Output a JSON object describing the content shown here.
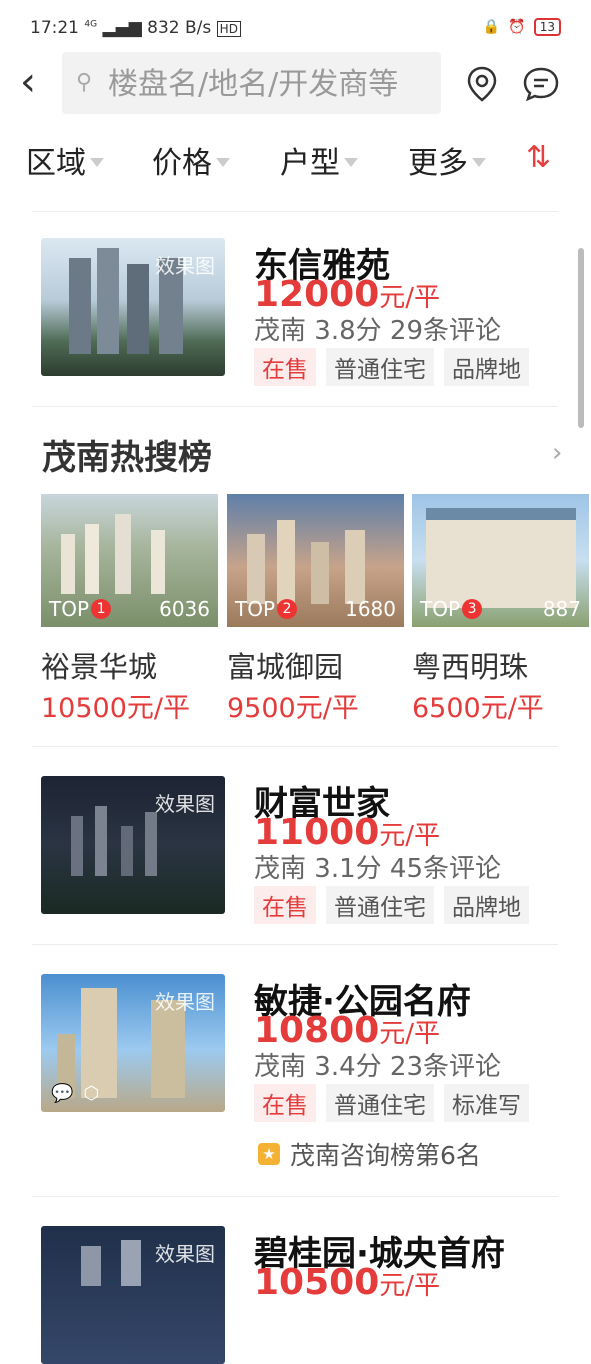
{
  "status": {
    "time": "17:21",
    "net": "4G",
    "speed": "832 B/s",
    "hd": "HD",
    "battery": "13"
  },
  "search": {
    "placeholder": "楼盘名/地名/开发商等"
  },
  "filters": [
    {
      "label": "区域"
    },
    {
      "label": "价格"
    },
    {
      "label": "户型"
    },
    {
      "label": "更多"
    }
  ],
  "listings": [
    {
      "title": "东信雅苑",
      "price": "12000",
      "unit": "元/平",
      "city": "茂南",
      "score": "3.8分",
      "reviews": "29条评论",
      "tags": [
        "在售",
        "普通住宅",
        "品牌地"
      ],
      "img_tag": "效果图"
    },
    {
      "title": "财富世家",
      "price": "11000",
      "unit": "元/平",
      "city": "茂南",
      "score": "3.1分",
      "reviews": "45条评论",
      "tags": [
        "在售",
        "普通住宅",
        "品牌地"
      ],
      "img_tag": "效果图"
    },
    {
      "title": "敏捷·公园名府",
      "price": "10800",
      "unit": "元/平",
      "city": "茂南",
      "score": "3.4分",
      "reviews": "23条评论",
      "tags": [
        "在售",
        "普通住宅",
        "标准写"
      ],
      "img_tag": "效果图",
      "rank": "茂南咨询榜第6名"
    },
    {
      "title": "碧桂园·城央首府",
      "price": "10500",
      "unit": "元/平",
      "img_tag": "效果图"
    }
  ],
  "hot": {
    "title": "茂南热搜榜",
    "items": [
      {
        "top": "TOP",
        "rank": "1",
        "count": "6036",
        "name": "裕景华城",
        "price": "10500元/平"
      },
      {
        "top": "TOP",
        "rank": "2",
        "count": "1680",
        "name": "富城御园",
        "price": "9500元/平"
      },
      {
        "top": "TOP",
        "rank": "3",
        "count": "887",
        "name": "粤西明珠",
        "price": "6500元/平"
      }
    ]
  },
  "colors": {
    "accent": "#e43b3b"
  }
}
